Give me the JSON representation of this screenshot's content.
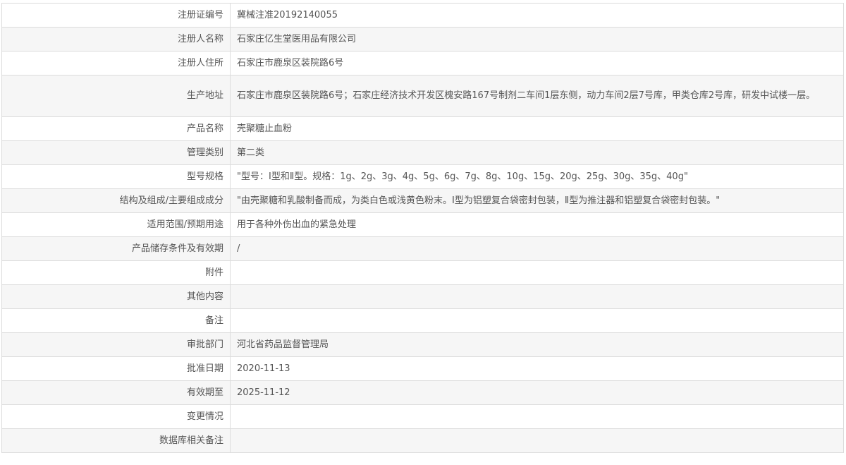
{
  "rows": [
    {
      "label": "注册证编号",
      "value": "冀械注准20192140055"
    },
    {
      "label": "注册人名称",
      "value": "石家庄亿生堂医用品有限公司"
    },
    {
      "label": "注册人住所",
      "value": "石家庄市鹿泉区装院路6号"
    },
    {
      "label": "生产地址",
      "value": "石家庄市鹿泉区装院路6号；石家庄经济技术开发区槐安路167号制剂二车间1层东侧，动力车间2层7号库，甲类仓库2号库，研发中试楼一层。"
    },
    {
      "label": "产品名称",
      "value": "壳聚糖止血粉"
    },
    {
      "label": "管理类别",
      "value": "第二类"
    },
    {
      "label": "型号规格",
      "value": "\"型号：Ⅰ型和Ⅱ型。规格：1g、2g、3g、4g、5g、6g、7g、8g、10g、15g、20g、25g、30g、35g、40g\""
    },
    {
      "label": "结构及组成/主要组成成分",
      "value": "\"由壳聚糖和乳酸制备而成，为类白色或浅黄色粉末。Ⅰ型为铝塑复合袋密封包装，Ⅱ型为推注器和铝塑复合袋密封包装。\""
    },
    {
      "label": "适用范围/预期用途",
      "value": "用于各种外伤出血的紧急处理"
    },
    {
      "label": "产品储存条件及有效期",
      "value": "/"
    },
    {
      "label": "附件",
      "value": ""
    },
    {
      "label": "其他内容",
      "value": ""
    },
    {
      "label": "备注",
      "value": ""
    },
    {
      "label": "审批部门",
      "value": "河北省药品监督管理局"
    },
    {
      "label": "批准日期",
      "value": "2020-11-13"
    },
    {
      "label": "有效期至",
      "value": "2025-11-12"
    },
    {
      "label": "变更情况",
      "value": ""
    },
    {
      "label": "数据库相关备注",
      "value": ""
    }
  ]
}
